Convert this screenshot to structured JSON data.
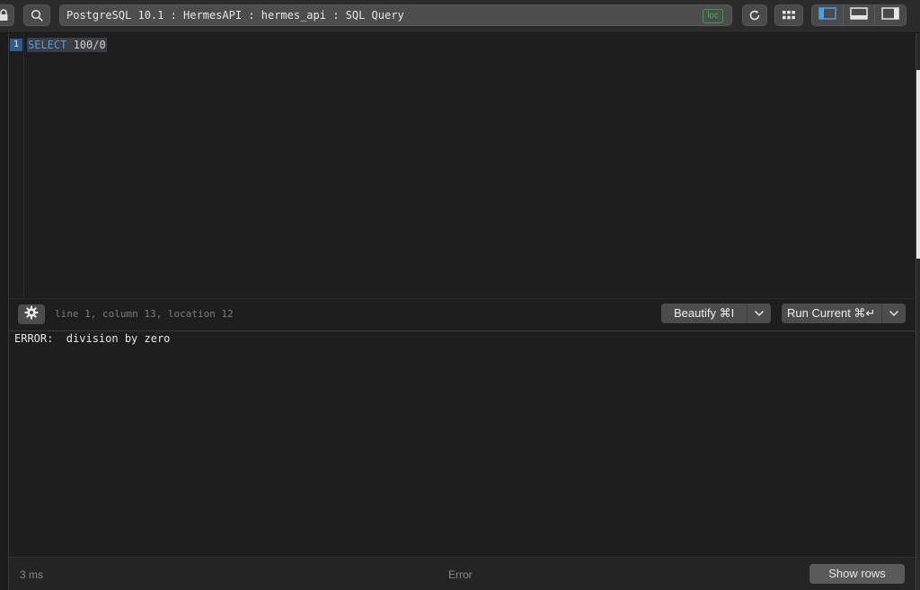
{
  "toolbar": {
    "address": "PostgreSQL 10.1 : HermesAPI : hermes_api : SQL Query",
    "loc_badge": "loc",
    "icons": {
      "lock": "lock-icon",
      "search": "search-icon",
      "refresh": "refresh-icon",
      "grid": "grid-icon",
      "left_panel": "left-panel-icon",
      "bottom_panel": "bottom-panel-icon",
      "right_panel": "right-panel-icon"
    },
    "colors": {
      "loc_badge": "#4caf50",
      "active_view": "#4a9ee8"
    }
  },
  "editor": {
    "line_number": "1",
    "keyword": "SELECT",
    "expression": " 100/0",
    "keyword_color": "#569cd6"
  },
  "editor_bar": {
    "settings_icon": "gear-icon",
    "cursor_position": "line 1, column 13, location 12",
    "beautify_label": "Beautify ⌘I",
    "run_label": "Run Current ⌘↵",
    "dropdown_icon": "chevron-down-icon"
  },
  "results": {
    "error": "ERROR:  division by zero"
  },
  "footer": {
    "timing": "3 ms",
    "status": "Error",
    "show_rows_label": "Show rows"
  }
}
